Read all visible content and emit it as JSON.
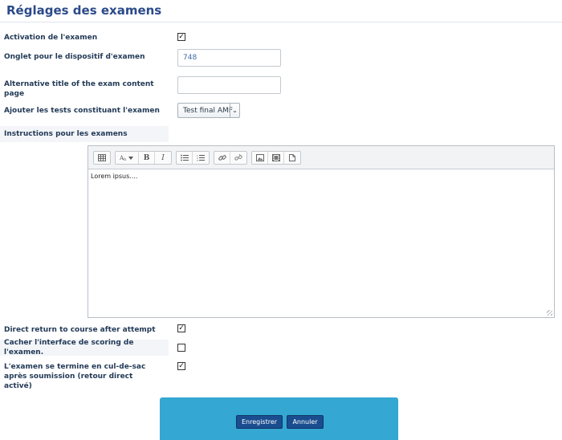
{
  "page": {
    "title": "Réglages des examens"
  },
  "fields": {
    "activation": {
      "label": "Activation de l'examen",
      "checked": true
    },
    "onglet": {
      "label": "Onglet pour le dispositif d'examen",
      "value": "748"
    },
    "alt_title": {
      "label": "Alternative title of the exam content page",
      "value": ""
    },
    "tests": {
      "label": "Ajouter les tests constituant l'examen",
      "selected": "Test final AMF"
    },
    "instructions": {
      "label": "Instructions pour les examens",
      "content": "Lorem ipsus...."
    },
    "direct_return": {
      "label": "Direct return to course after attempt",
      "checked": true
    },
    "hide_scoring": {
      "label": "Cacher l'interface de scoring de l'examen.",
      "checked": false
    },
    "dead_end": {
      "label": "L'examen se termine en cul-de-sac après soumission (retour direct activé)",
      "checked": true
    }
  },
  "checkmark": "✓",
  "toolbar": {
    "icons": [
      "table-icon",
      "text-style-icon",
      "bold-icon",
      "italic-icon",
      "bullet-list-icon",
      "numbered-list-icon",
      "link-icon",
      "unlink-icon",
      "image-icon",
      "media-icon",
      "file-icon"
    ],
    "bold_glyph": "B",
    "italic_glyph": "I"
  },
  "actions": {
    "save": "Enregistrer",
    "cancel": "Annuler"
  },
  "colors": {
    "title": "#2b4a8a",
    "footer": "#34a7d2",
    "button": "#1a4d8f"
  }
}
